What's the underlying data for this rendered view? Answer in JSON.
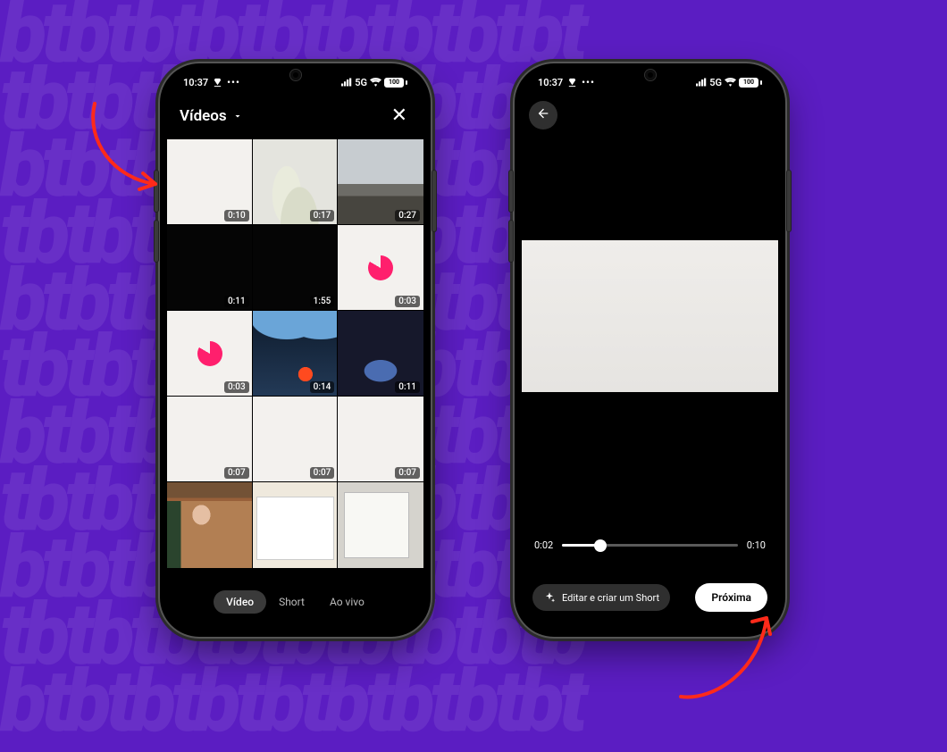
{
  "status": {
    "time": "10:37",
    "network_label": "5G",
    "battery_pct": "100"
  },
  "phone1": {
    "picker_title": "Vídeos",
    "tabs": {
      "video": "Vídeo",
      "short": "Short",
      "live": "Ao vivo"
    },
    "thumbs": [
      {
        "duration": "0:10",
        "kind": "bg-white"
      },
      {
        "duration": "0:17",
        "kind": "plant"
      },
      {
        "duration": "0:27",
        "kind": "rooftop"
      },
      {
        "duration": "0:11",
        "kind": "bg-black"
      },
      {
        "duration": "1:55",
        "kind": "bg-black"
      },
      {
        "duration": "0:03",
        "kind": "bg-white pink"
      },
      {
        "duration": "0:03",
        "kind": "bg-white pink"
      },
      {
        "duration": "0:14",
        "kind": "concert"
      },
      {
        "duration": "0:11",
        "kind": "crowd-dark"
      },
      {
        "duration": "0:07",
        "kind": "bg-white"
      },
      {
        "duration": "0:07",
        "kind": "bg-white"
      },
      {
        "duration": "0:07",
        "kind": "bg-white"
      },
      {
        "duration": "",
        "kind": "person"
      },
      {
        "duration": "",
        "kind": "desktop1"
      },
      {
        "duration": "",
        "kind": "desktop2"
      }
    ]
  },
  "phone2": {
    "scrubber": {
      "current": "0:02",
      "total": "0:10",
      "progress_pct": 22
    },
    "edit_label": "Editar e criar um Short",
    "next_label": "Próxima"
  }
}
